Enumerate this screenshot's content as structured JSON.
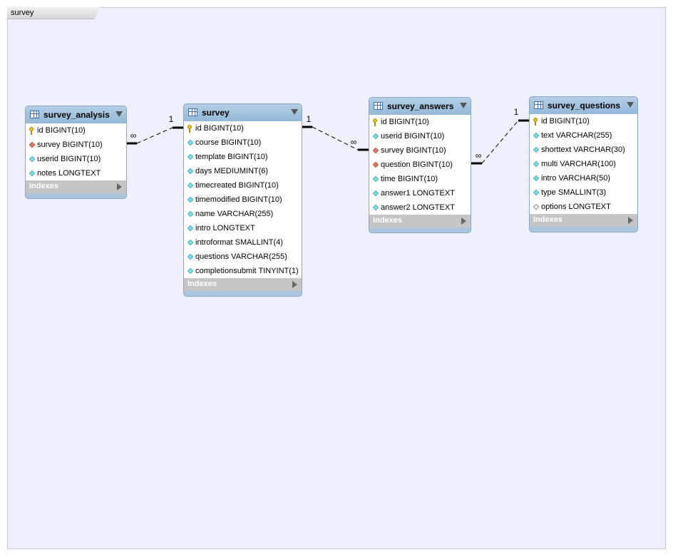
{
  "layer": {
    "name": "survey"
  },
  "entities": {
    "survey_analysis": {
      "title": "survey_analysis",
      "columns": [
        {
          "label": "id BIGINT(10)",
          "icon": "primary-key-icon"
        },
        {
          "label": "survey BIGINT(10)",
          "icon": "foreign-key-icon"
        },
        {
          "label": "userid BIGINT(10)",
          "icon": "column-icon"
        },
        {
          "label": "notes LONGTEXT",
          "icon": "column-icon"
        }
      ],
      "indexes": "Indexes"
    },
    "survey": {
      "title": "survey",
      "columns": [
        {
          "label": "id BIGINT(10)",
          "icon": "primary-key-icon"
        },
        {
          "label": "course BIGINT(10)",
          "icon": "column-icon"
        },
        {
          "label": "template BIGINT(10)",
          "icon": "column-icon"
        },
        {
          "label": "days MEDIUMINT(6)",
          "icon": "column-icon"
        },
        {
          "label": "timecreated BIGINT(10)",
          "icon": "column-icon"
        },
        {
          "label": "timemodified BIGINT(10)",
          "icon": "column-icon"
        },
        {
          "label": "name VARCHAR(255)",
          "icon": "column-icon"
        },
        {
          "label": "intro LONGTEXT",
          "icon": "column-icon"
        },
        {
          "label": "introformat SMALLINT(4)",
          "icon": "column-icon"
        },
        {
          "label": "questions VARCHAR(255)",
          "icon": "column-icon"
        },
        {
          "label": "completionsubmit TINYINT(1)",
          "icon": "column-icon"
        }
      ],
      "indexes": "Indexes"
    },
    "survey_answers": {
      "title": "survey_answers",
      "columns": [
        {
          "label": "id BIGINT(10)",
          "icon": "primary-key-icon"
        },
        {
          "label": "userid BIGINT(10)",
          "icon": "column-icon"
        },
        {
          "label": "survey BIGINT(10)",
          "icon": "foreign-key-icon"
        },
        {
          "label": "question BIGINT(10)",
          "icon": "foreign-key-icon"
        },
        {
          "label": "time BIGINT(10)",
          "icon": "column-icon"
        },
        {
          "label": "answer1 LONGTEXT",
          "icon": "column-icon"
        },
        {
          "label": "answer2 LONGTEXT",
          "icon": "column-icon"
        }
      ],
      "indexes": "Indexes"
    },
    "survey_questions": {
      "title": "survey_questions",
      "columns": [
        {
          "label": "id BIGINT(10)",
          "icon": "primary-key-icon"
        },
        {
          "label": "text VARCHAR(255)",
          "icon": "column-icon"
        },
        {
          "label": "shorttext VARCHAR(30)",
          "icon": "column-icon"
        },
        {
          "label": "multi VARCHAR(100)",
          "icon": "column-icon"
        },
        {
          "label": "intro VARCHAR(50)",
          "icon": "column-icon"
        },
        {
          "label": "type SMALLINT(3)",
          "icon": "column-icon"
        },
        {
          "label": "options LONGTEXT",
          "icon": "nullable-column-icon"
        }
      ],
      "indexes": "Indexes"
    }
  },
  "relationships": [
    {
      "from": "survey_analysis",
      "to": "survey",
      "from_card": "∞",
      "to_card": "1"
    },
    {
      "from": "survey",
      "to": "survey_answers",
      "from_card": "1",
      "to_card": "∞"
    },
    {
      "from": "survey_answers",
      "to": "survey_questions",
      "from_card": "∞",
      "to_card": "1"
    }
  ],
  "colors": {
    "canvas": "#eef0fd",
    "header": "#a9c6de",
    "pk": "#e8c21f",
    "fk": "#dd7a6a",
    "column": "#7fe0e3"
  }
}
